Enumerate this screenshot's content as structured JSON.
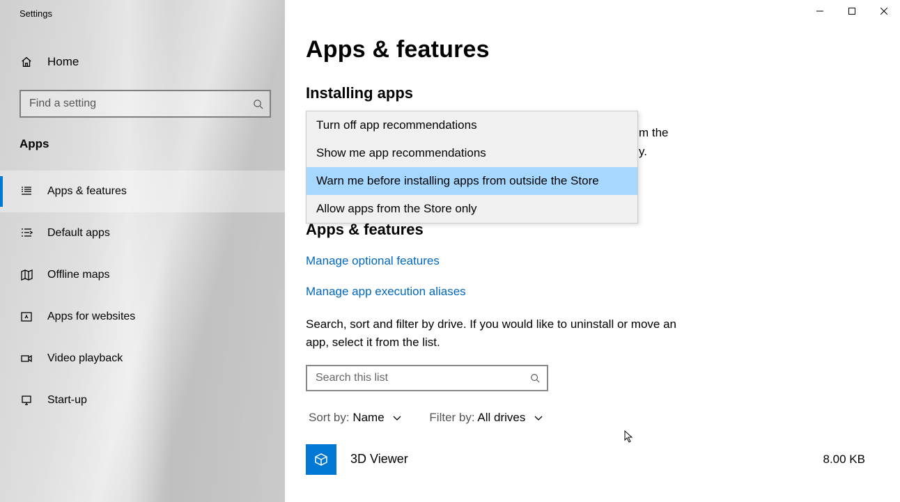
{
  "window": {
    "title": "Settings"
  },
  "sidebar": {
    "home": "Home",
    "search_placeholder": "Find a setting",
    "category": "Apps",
    "items": [
      {
        "label": "Apps & features",
        "icon": "apps-features-icon",
        "active": true
      },
      {
        "label": "Default apps",
        "icon": "default-apps-icon",
        "active": false
      },
      {
        "label": "Offline maps",
        "icon": "offline-maps-icon",
        "active": false
      },
      {
        "label": "Apps for websites",
        "icon": "apps-websites-icon",
        "active": false
      },
      {
        "label": "Video playback",
        "icon": "video-playback-icon",
        "active": false
      },
      {
        "label": "Start-up",
        "icon": "startup-icon",
        "active": false
      }
    ]
  },
  "main": {
    "title": "Apps & features",
    "section_installing": "Installing apps",
    "desc_frag1": "m the",
    "desc_frag2": "y.",
    "section_apps": "Apps & features",
    "link_optional": "Manage optional features",
    "link_aliases": "Manage app execution aliases",
    "filter_desc": "Search, sort and filter by drive. If you would like to uninstall or move an app, select it from the list.",
    "list_search_placeholder": "Search this list",
    "sort_label": "Sort by:",
    "sort_value": "Name",
    "filter_label": "Filter by:",
    "filter_value": "All drives",
    "app": {
      "name": "3D Viewer",
      "size": "8.00 KB"
    }
  },
  "dropdown": {
    "options": [
      "Turn off app recommendations",
      "Show me app recommendations",
      "Warn me before installing apps from outside the Store",
      "Allow apps from the Store only"
    ],
    "highlight_index": 2
  }
}
